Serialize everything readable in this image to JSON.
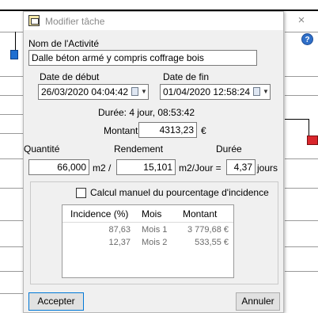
{
  "window": {
    "title": "Modifier tâche",
    "close_glyph": "×",
    "help_glyph": "?"
  },
  "activity": {
    "label": "Nom de l'Activité",
    "value": "Dalle béton armé y compris coffrage bois"
  },
  "dates": {
    "start_label": "Date de début",
    "start_value": "26/03/2020 04:04:42",
    "end_label": "Date de fin",
    "end_value": "01/04/2020 12:58:24"
  },
  "duration_text": "Durée: 4 jour, 08:53:42",
  "amount": {
    "label": "Montant",
    "value": "4313,23",
    "unit": "€"
  },
  "quantities": {
    "qty_label": "Quantité",
    "qty_value": "66,000",
    "qty_unit": "m2 /",
    "yield_label": "Rendement",
    "yield_value": "15,101",
    "yield_unit": "m2/Jour =",
    "dur_label": "Durée",
    "dur_value": "4,37",
    "dur_unit": "jours"
  },
  "incidence": {
    "checkbox_label": "Calcul manuel du pourcentage d'incidence",
    "checked": false,
    "columns": [
      "Incidence (%)",
      "Mois",
      "Montant"
    ],
    "rows": [
      [
        "87,63",
        "Mois 1",
        "3 779,68 €"
      ],
      [
        "12,37",
        "Mois 2",
        "533,55 €"
      ]
    ]
  },
  "buttons": {
    "accept": "Accepter",
    "cancel": "Annuler"
  },
  "colors": {
    "accent": "#0078d7",
    "gantt_blue": "#1f6fd1",
    "gantt_red": "#d9262c"
  }
}
